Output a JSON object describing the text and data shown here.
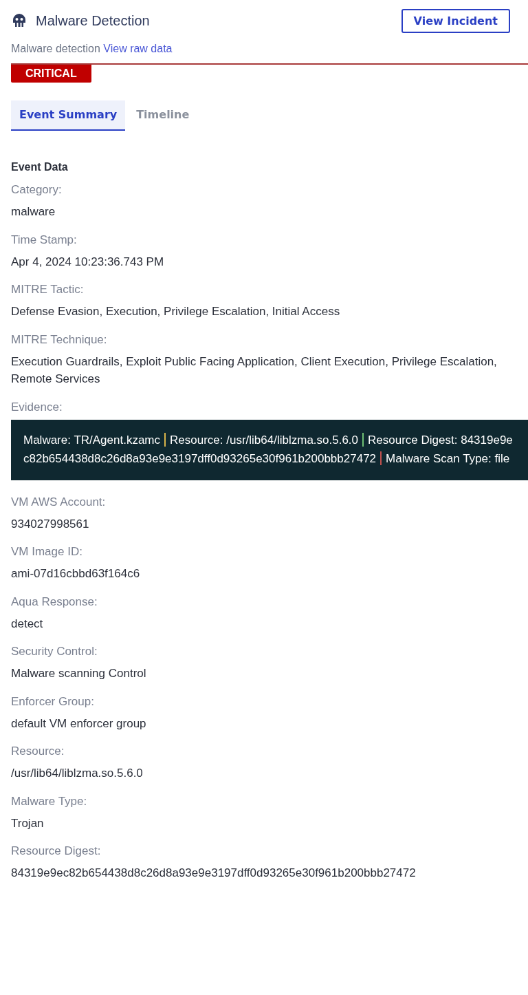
{
  "header": {
    "title": "Malware Detection",
    "button": "View Incident"
  },
  "subtitle": {
    "text": "Malware detection",
    "link": "View raw data"
  },
  "severity": "CRITICAL",
  "tabs": [
    {
      "label": "Event Summary",
      "selected": true
    },
    {
      "label": "Timeline",
      "selected": false
    }
  ],
  "section_title": "Event Data",
  "fields_before": [
    {
      "label": "Category:",
      "value": "malware"
    },
    {
      "label": "Time Stamp:",
      "value": "Apr 4, 2024 10:23:36.743 PM"
    },
    {
      "label": "MITRE Tactic:",
      "value": "Defense Evasion, Execution, Privilege Escalation, Initial Access"
    },
    {
      "label": "MITRE Technique:",
      "value": "Execution Guardrails, Exploit Public Facing Application, Client Execution, Privilege Escalation, Remote Services"
    }
  ],
  "evidence": {
    "label": "Evidence:",
    "segments": [
      {
        "text": "Malware: TR/Agent.kzamc",
        "color": "#d9b44a"
      },
      {
        "text": "Resource: /usr/lib64/liblzma.so.5.6.0",
        "color": "#6fbf73"
      },
      {
        "text": "Resource Digest: 84319e9ec82b654438d8c26d8a93e9e3197dff0d93265e30f961b200bbb27472",
        "color": "#c0504d"
      },
      {
        "text": "Malware Scan Type: file"
      }
    ]
  },
  "fields_after": [
    {
      "label": "VM AWS Account:",
      "value": "934027998561"
    },
    {
      "label": "VM Image ID:",
      "value": "ami-07d16cbbd63f164c6"
    },
    {
      "label": "Aqua Response:",
      "value": "detect"
    },
    {
      "label": "Security Control:",
      "value": "Malware scanning Control"
    },
    {
      "label": "Enforcer Group:",
      "value": "default VM enforcer group"
    },
    {
      "label": "Resource:",
      "value": "/usr/lib64/liblzma.so.5.6.0"
    },
    {
      "label": "Malware Type:",
      "value": "Trojan"
    },
    {
      "label": "Resource Digest:",
      "value": "84319e9ec82b654438d8c26d8a93e9e3197dff0d93265e30f961b200bbb27472"
    }
  ]
}
